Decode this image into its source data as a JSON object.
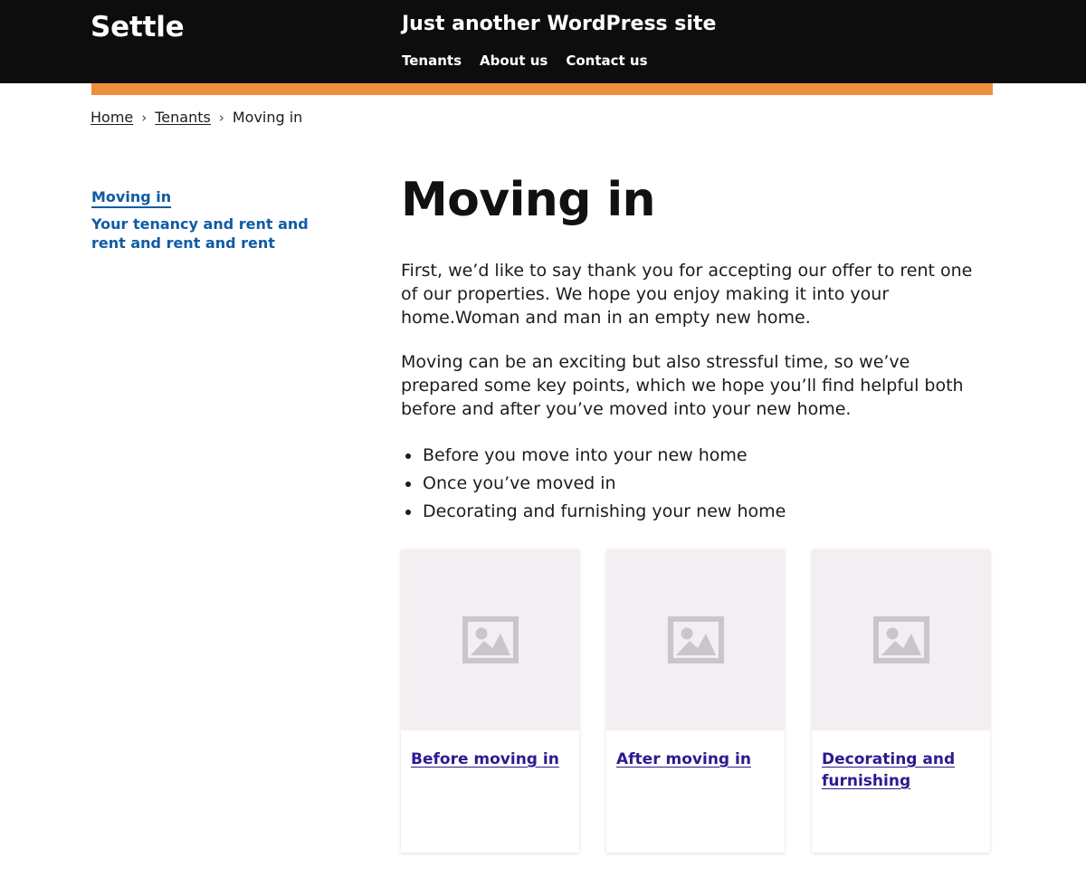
{
  "header": {
    "logo": "Settle",
    "tagline": "Just another WordPress site",
    "nav": [
      {
        "label": "Tenants"
      },
      {
        "label": "About us"
      },
      {
        "label": "Contact us"
      }
    ],
    "accent_color": "#ef8f3c",
    "background_color": "#0d0d0d"
  },
  "breadcrumb": {
    "separator": "›",
    "items": [
      {
        "label": "Home",
        "is_link": true
      },
      {
        "label": "Tenants",
        "is_link": true
      },
      {
        "label": "Moving in",
        "is_link": false
      }
    ]
  },
  "sidebar": {
    "link_color": "#115ba5",
    "items": [
      {
        "label": "Moving in",
        "active": true
      },
      {
        "label": "Your tenancy and rent and rent and rent and rent",
        "active": false
      }
    ]
  },
  "main": {
    "title": "Moving in",
    "paragraphs": [
      "First, we’d like to say thank you for accepting our offer to rent one of our properties. We hope you enjoy making it into your home.Woman and man in an empty new home.",
      "Moving can be an exciting but also stressful time, so we’ve prepared some key points, which we hope you’ll find helpful both before and after you’ve moved into your new home."
    ],
    "bullets": [
      "Before you move into your new home",
      "Once you’ve moved in",
      "Decorating and furnishing your new home"
    ]
  },
  "cards": {
    "link_color": "#2d1a8f",
    "placeholder_icon": "image-placeholder-icon",
    "items": [
      {
        "title": "Before moving in"
      },
      {
        "title": "After moving in"
      },
      {
        "title": "Decorating and furnishing"
      }
    ]
  }
}
